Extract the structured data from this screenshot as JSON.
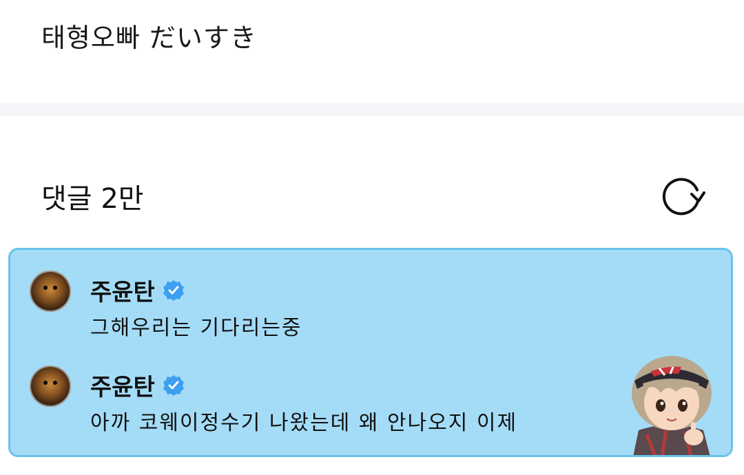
{
  "post": {
    "text": "태형오빠 だいすき"
  },
  "comments_section": {
    "header": "댓글 2만",
    "refresh_icon": "refresh-icon"
  },
  "comments": [
    {
      "username": "주윤탄",
      "verified_icon": "verified-badge-icon",
      "text": "그해우리는 기다리는중"
    },
    {
      "username": "주윤탄",
      "verified_icon": "verified-badge-icon",
      "text": "아까 코웨이정수기 나왔는데 왜 안나오지 이제"
    }
  ],
  "colors": {
    "panel_bg": "#a4dcf7",
    "panel_border": "#68c3ea",
    "verified_blue": "#3d9ff0",
    "divider": "#f5f6fa"
  }
}
